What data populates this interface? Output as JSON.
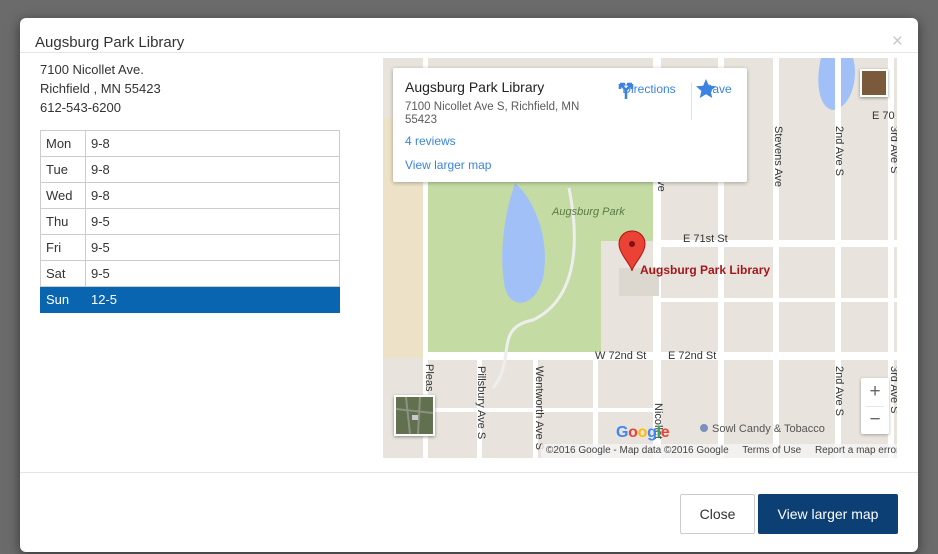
{
  "modal": {
    "title": "Augsburg Park Library",
    "close_glyph": "×"
  },
  "address": {
    "line1": "7100 Nicollet Ave.",
    "line2": "Richfield , MN 55423",
    "phone": "612-543-6200"
  },
  "hours": [
    {
      "day": "Mon",
      "time": "9-8"
    },
    {
      "day": "Tue",
      "time": "9-8"
    },
    {
      "day": "Wed",
      "time": "9-8"
    },
    {
      "day": "Thu",
      "time": "9-5"
    },
    {
      "day": "Fri",
      "time": "9-5"
    },
    {
      "day": "Sat",
      "time": "9-5"
    },
    {
      "day": "Sun",
      "time": "12-5"
    }
  ],
  "hours_active_day": "Sun",
  "map": {
    "info": {
      "name": "Augsburg Park Library",
      "address": "7100 Nicollet Ave S, Richfield, MN 55423",
      "reviews": "4 reviews",
      "view_larger": "View larger map",
      "directions": "Directions",
      "save": "Save"
    },
    "labels": {
      "park": "Augsburg Park",
      "marker": "Augsburg Park Library",
      "e71": "E 71st St",
      "w72": "W 72nd St",
      "e72": "E 72nd St",
      "stevens": "Stevens Ave",
      "second_ave": "2nd Ave S",
      "third_ave": "3rd Ave S",
      "pillsbury": "Pillsbury Ave S",
      "wentworth": "Wentworth Ave S",
      "nicollet": "Nicollet",
      "pleas": "Pleas",
      "e70": "E 70",
      "sowl": "Sowl Candy & Tobacco",
      "ave_frag": "Ave"
    },
    "attribution": {
      "copyright": "©2016 Google - Map data ©2016 Google",
      "terms": "Terms of Use",
      "report": "Report a map error"
    },
    "zoom_in": "+",
    "zoom_out": "−",
    "colors": {
      "land": "#e8e4dd",
      "park": "#c4dca4",
      "water": "#a1c0f8",
      "road": "#ffffff",
      "marker": "#ea4335",
      "accent": "#3a84df"
    }
  },
  "footer": {
    "close_label": "Close",
    "larger_label": "View larger map"
  }
}
